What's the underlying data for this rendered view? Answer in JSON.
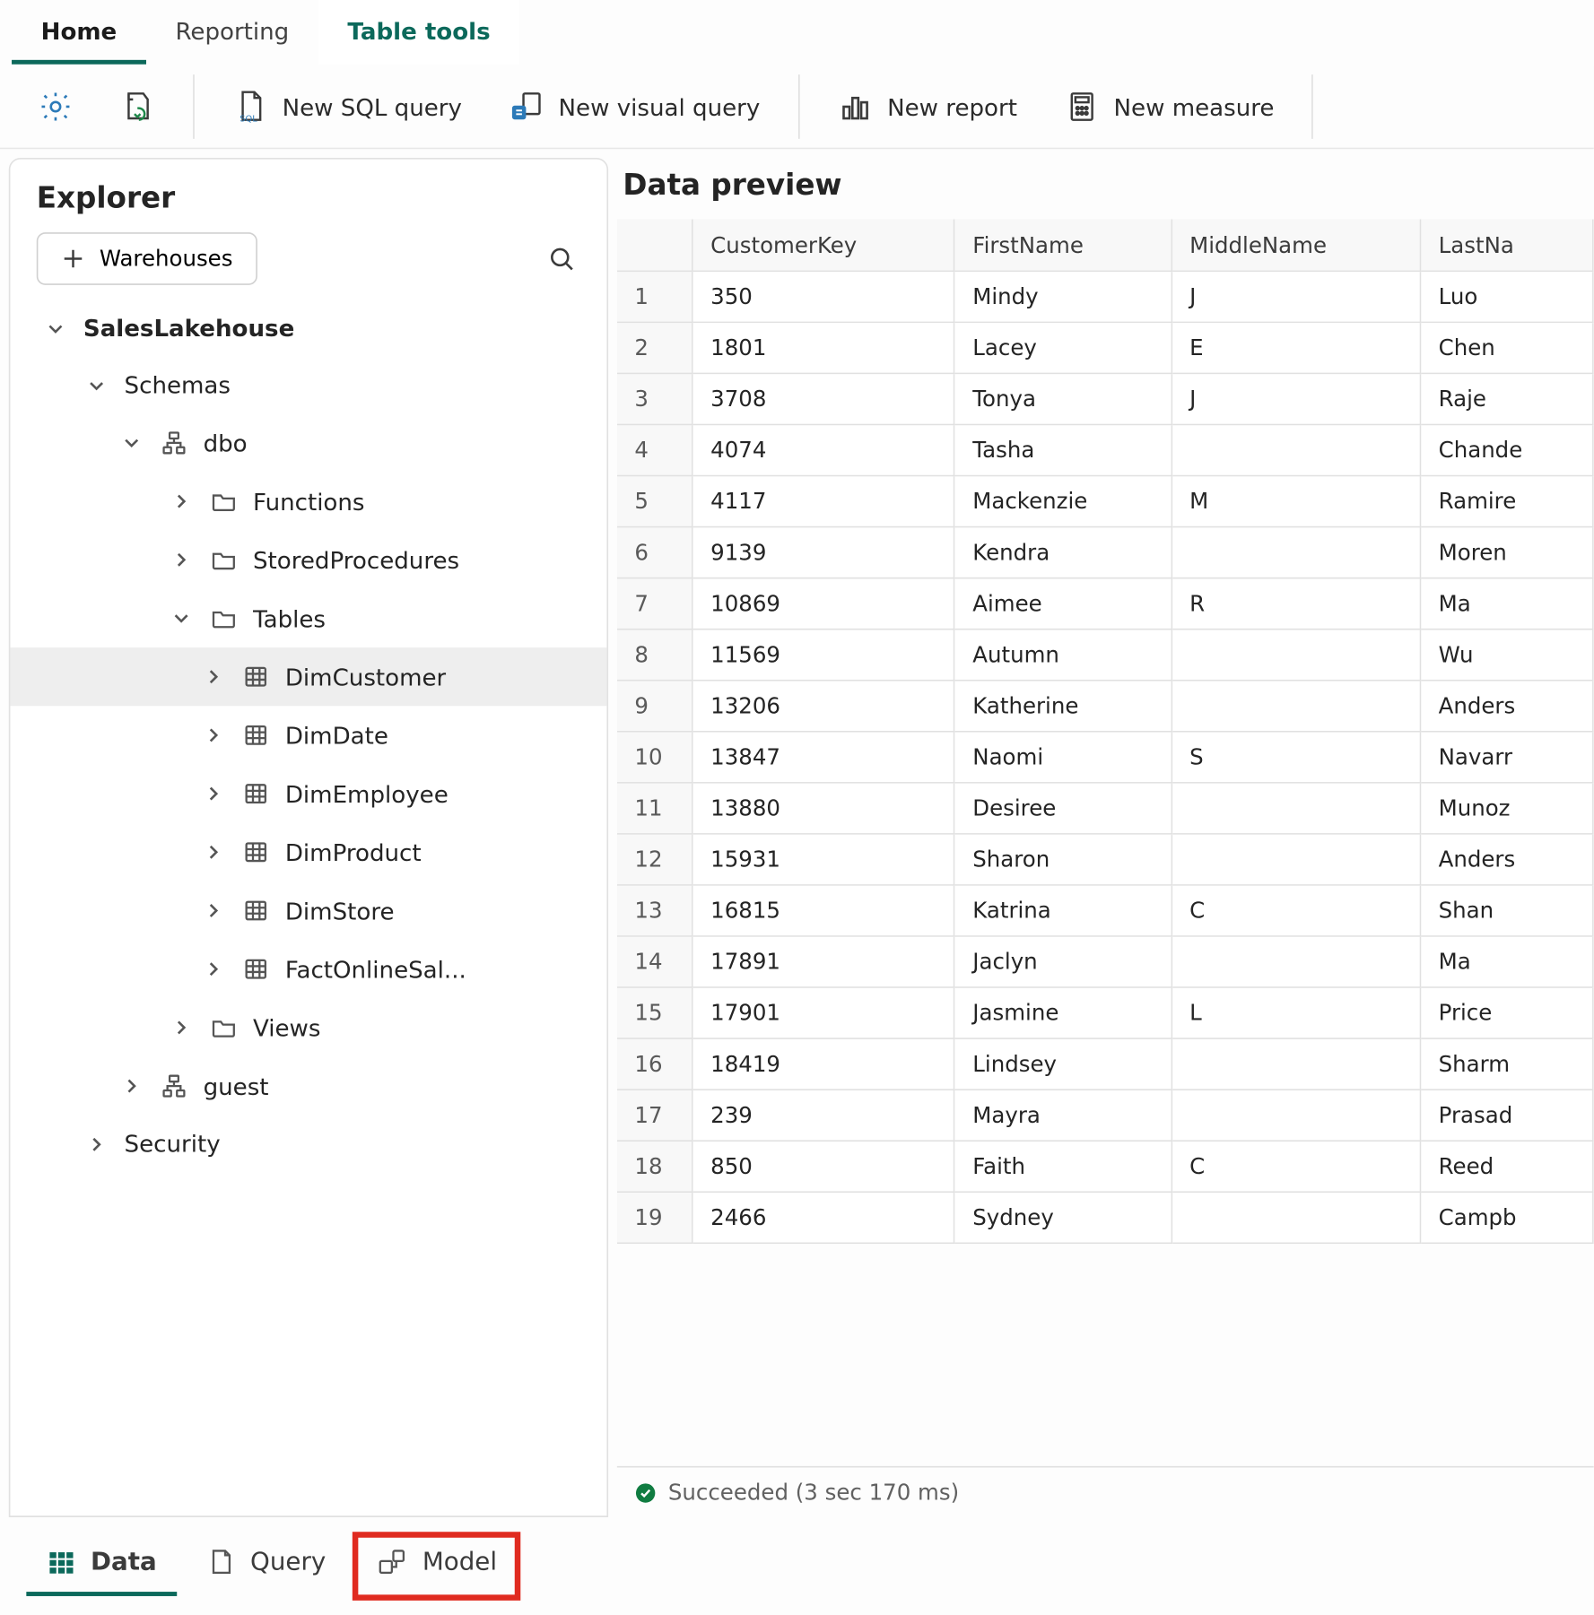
{
  "ribbon_tabs": {
    "home": "Home",
    "reporting": "Reporting",
    "table_tools": "Table tools"
  },
  "ribbon": {
    "new_sql": "New SQL query",
    "new_visual": "New visual query",
    "new_report": "New report",
    "new_measure": "New measure"
  },
  "explorer": {
    "title": "Explorer",
    "warehouses_btn": "Warehouses",
    "root": "SalesLakehouse",
    "schemas": "Schemas",
    "dbo": "dbo",
    "functions": "Functions",
    "stored_procedures": "StoredProcedures",
    "tables": "Tables",
    "tablelist": [
      "DimCustomer",
      "DimDate",
      "DimEmployee",
      "DimProduct",
      "DimStore",
      "FactOnlineSal..."
    ],
    "views": "Views",
    "guest": "guest",
    "security": "Security"
  },
  "main": {
    "title": "Data preview",
    "columns": [
      "",
      "CustomerKey",
      "FirstName",
      "MiddleName",
      "LastNa"
    ],
    "rows": [
      {
        "n": "1",
        "CustomerKey": "350",
        "FirstName": "Mindy",
        "MiddleName": "J",
        "LastNa": "Luo"
      },
      {
        "n": "2",
        "CustomerKey": "1801",
        "FirstName": "Lacey",
        "MiddleName": "E",
        "LastNa": "Chen"
      },
      {
        "n": "3",
        "CustomerKey": "3708",
        "FirstName": "Tonya",
        "MiddleName": "J",
        "LastNa": "Raje"
      },
      {
        "n": "4",
        "CustomerKey": "4074",
        "FirstName": "Tasha",
        "MiddleName": "",
        "LastNa": "Chande"
      },
      {
        "n": "5",
        "CustomerKey": "4117",
        "FirstName": "Mackenzie",
        "MiddleName": "M",
        "LastNa": "Ramire"
      },
      {
        "n": "6",
        "CustomerKey": "9139",
        "FirstName": "Kendra",
        "MiddleName": "",
        "LastNa": "Moren"
      },
      {
        "n": "7",
        "CustomerKey": "10869",
        "FirstName": "Aimee",
        "MiddleName": "R",
        "LastNa": "Ma"
      },
      {
        "n": "8",
        "CustomerKey": "11569",
        "FirstName": "Autumn",
        "MiddleName": "",
        "LastNa": "Wu"
      },
      {
        "n": "9",
        "CustomerKey": "13206",
        "FirstName": "Katherine",
        "MiddleName": "",
        "LastNa": "Anders"
      },
      {
        "n": "10",
        "CustomerKey": "13847",
        "FirstName": "Naomi",
        "MiddleName": "S",
        "LastNa": "Navarr"
      },
      {
        "n": "11",
        "CustomerKey": "13880",
        "FirstName": "Desiree",
        "MiddleName": "",
        "LastNa": "Munoz"
      },
      {
        "n": "12",
        "CustomerKey": "15931",
        "FirstName": "Sharon",
        "MiddleName": "",
        "LastNa": "Anders"
      },
      {
        "n": "13",
        "CustomerKey": "16815",
        "FirstName": "Katrina",
        "MiddleName": "C",
        "LastNa": "Shan"
      },
      {
        "n": "14",
        "CustomerKey": "17891",
        "FirstName": "Jaclyn",
        "MiddleName": "",
        "LastNa": "Ma"
      },
      {
        "n": "15",
        "CustomerKey": "17901",
        "FirstName": "Jasmine",
        "MiddleName": "L",
        "LastNa": "Price"
      },
      {
        "n": "16",
        "CustomerKey": "18419",
        "FirstName": "Lindsey",
        "MiddleName": "",
        "LastNa": "Sharm"
      },
      {
        "n": "17",
        "CustomerKey": "239",
        "FirstName": "Mayra",
        "MiddleName": "",
        "LastNa": "Prasad"
      },
      {
        "n": "18",
        "CustomerKey": "850",
        "FirstName": "Faith",
        "MiddleName": "C",
        "LastNa": "Reed"
      },
      {
        "n": "19",
        "CustomerKey": "2466",
        "FirstName": "Sydney",
        "MiddleName": "",
        "LastNa": "Campb"
      }
    ],
    "status": "Succeeded (3 sec 170 ms)"
  },
  "bottom_tabs": {
    "data": "Data",
    "query": "Query",
    "model": "Model"
  }
}
